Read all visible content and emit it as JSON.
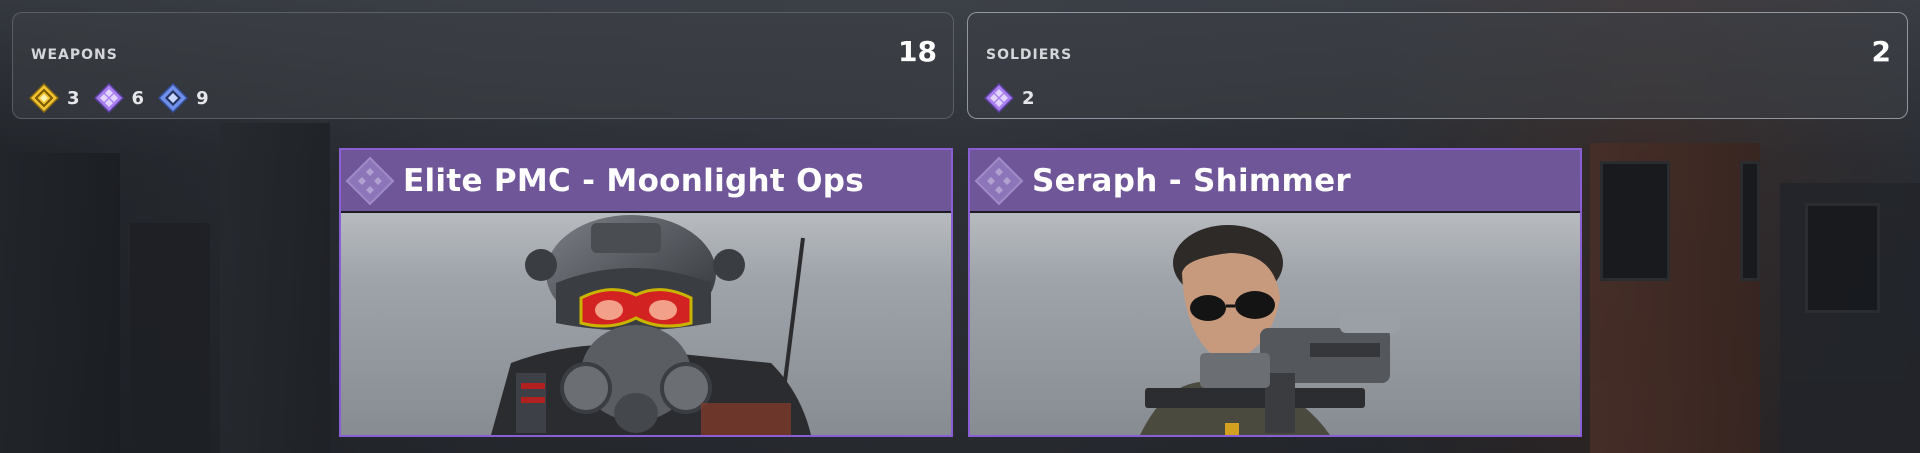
{
  "weapons": {
    "label": "WEAPONS",
    "total": "18",
    "rarities": [
      {
        "icon": "legendary-gem-icon",
        "color": "#f1c232",
        "count": "3"
      },
      {
        "icon": "epic-gem-icon",
        "color": "#a97ff0",
        "count": "6"
      },
      {
        "icon": "rare-gem-icon",
        "color": "#6f8fe8",
        "count": "9"
      }
    ]
  },
  "soldiers": {
    "label": "SOLDIERS",
    "total": "2",
    "rarities": [
      {
        "icon": "epic-gem-icon",
        "color": "#a97ff0",
        "count": "2"
      }
    ]
  },
  "cards": [
    {
      "title": "Elite PMC - Moonlight Ops",
      "header_color": "#6e5699",
      "border_color": "#8a5fd6"
    },
    {
      "title": "Seraph - Shimmer",
      "header_color": "#6e5699",
      "border_color": "#8a5fd6"
    }
  ]
}
